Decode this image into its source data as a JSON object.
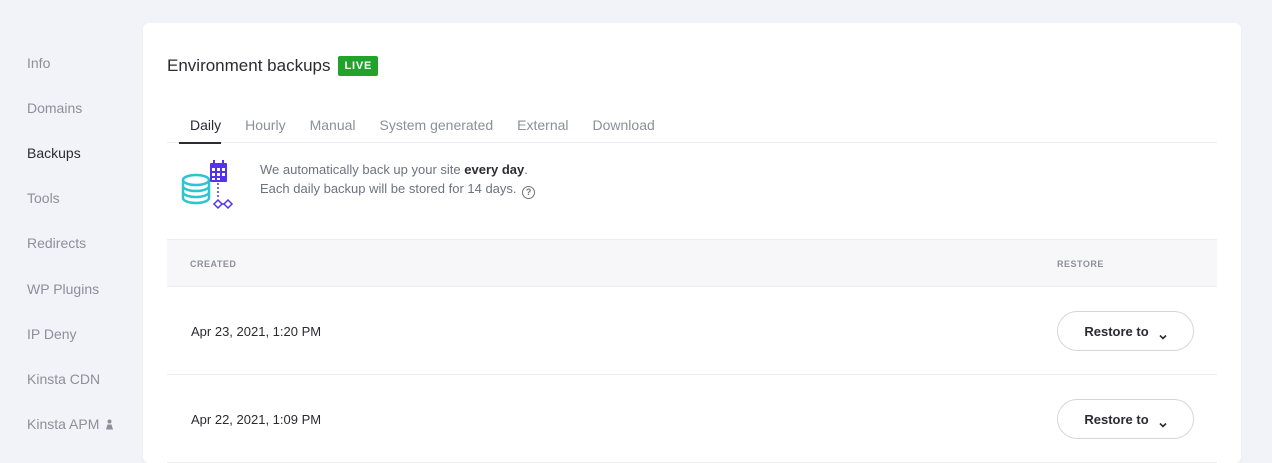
{
  "sidebar": {
    "items": [
      {
        "label": "Info",
        "active": false
      },
      {
        "label": "Domains",
        "active": false
      },
      {
        "label": "Backups",
        "active": true
      },
      {
        "label": "Tools",
        "active": false
      },
      {
        "label": "Redirects",
        "active": false
      },
      {
        "label": "WP Plugins",
        "active": false
      },
      {
        "label": "IP Deny",
        "active": false
      },
      {
        "label": "Kinsta CDN",
        "active": false
      },
      {
        "label": "Kinsta APM",
        "active": false,
        "icon": "person-icon"
      }
    ]
  },
  "header": {
    "title": "Environment backups",
    "badge": "LIVE",
    "badge_color": "#21a32b"
  },
  "tabs": [
    {
      "label": "Daily",
      "active": true
    },
    {
      "label": "Hourly",
      "active": false
    },
    {
      "label": "Manual",
      "active": false
    },
    {
      "label": "System generated",
      "active": false
    },
    {
      "label": "External",
      "active": false
    },
    {
      "label": "Download",
      "active": false
    }
  ],
  "info": {
    "line1_prefix": "We automatically back up your site ",
    "line1_strong": "every day",
    "line1_suffix": ".",
    "line2": "Each daily backup will be stored for 14 days.",
    "help_glyph": "?"
  },
  "table": {
    "columns": {
      "created": "CREATED",
      "restore": "RESTORE"
    },
    "rows": [
      {
        "created": "Apr 23, 2021, 1:20 PM",
        "action": "Restore to"
      },
      {
        "created": "Apr 22, 2021, 1:09 PM",
        "action": "Restore to"
      }
    ]
  },
  "colors": {
    "accent_teal": "#2cc5cf",
    "accent_purple": "#5333ed"
  }
}
